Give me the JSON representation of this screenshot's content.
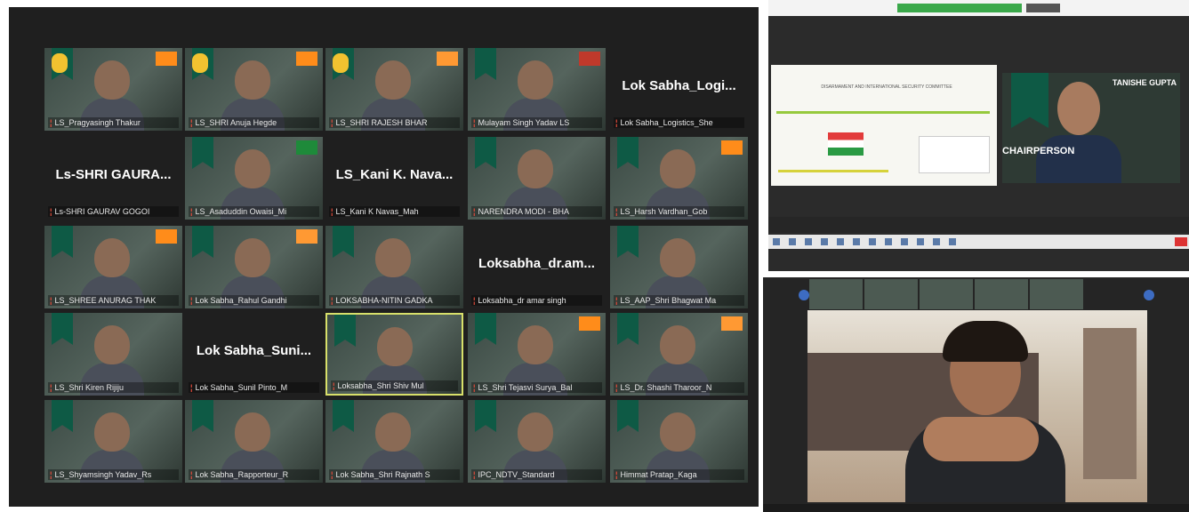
{
  "tiles": [
    {
      "label": "LS_Pragyasingh Thakur",
      "bigname": "",
      "flag": "#ff8c1a",
      "hand": true
    },
    {
      "label": "LS_SHRI Anuja Hegde",
      "bigname": "",
      "flag": "#ff8c1a",
      "hand": true
    },
    {
      "label": "LS_SHRI RAJESH BHAR",
      "bigname": "",
      "flag": "#ff9933",
      "hand": true
    },
    {
      "label": "Mulayam Singh Yadav LS",
      "bigname": "",
      "flag": "#c0392b",
      "hand": false
    },
    {
      "label": "Lok Sabha_Logistics_She",
      "bigname": "Lok Sabha_Logi...",
      "flag": "",
      "hand": false
    },
    {
      "label": "Ls-SHRI GAURAV GOGOI",
      "bigname": "Ls-SHRI GAURA...",
      "flag": "",
      "hand": false
    },
    {
      "label": "LS_Asaduddin Owaisi_Mi",
      "bigname": "",
      "flag": "#1e8a3a",
      "hand": false
    },
    {
      "label": "LS_Kani K Navas_Mah",
      "bigname": "LS_Kani K. Nava...",
      "flag": "",
      "hand": false
    },
    {
      "label": "NARENDRA MODI - BHA",
      "bigname": "",
      "flag": "",
      "hand": false
    },
    {
      "label": "LS_Harsh Vardhan_Gob",
      "bigname": "",
      "flag": "#ff8c1a",
      "hand": false
    },
    {
      "label": "LS_SHREE ANURAG THAK",
      "bigname": "",
      "flag": "#ff8c1a",
      "hand": false
    },
    {
      "label": "Lok Sabha_Rahul Gandhi",
      "bigname": "",
      "flag": "#ff9933",
      "hand": false
    },
    {
      "label": "LOKSABHA-NITIN GADKA",
      "bigname": "",
      "flag": "",
      "hand": false
    },
    {
      "label": "Loksabha_dr amar singh",
      "bigname": "Loksabha_dr.am...",
      "flag": "",
      "hand": false
    },
    {
      "label": "LS_AAP_Shri Bhagwat Ma",
      "bigname": "",
      "flag": "",
      "hand": false
    },
    {
      "label": "LS_Shri Kiren Rijiju",
      "bigname": "",
      "flag": "",
      "hand": false
    },
    {
      "label": "Lok Sabha_Sunil Pinto_M",
      "bigname": "Lok Sabha_Suni...",
      "flag": "",
      "hand": false
    },
    {
      "label": "Loksabha_Shri Shiv Mul",
      "bigname": "",
      "flag": "",
      "hand": false
    },
    {
      "label": "LS_Shri Tejasvi Surya_Bal",
      "bigname": "",
      "flag": "#ff8c1a",
      "hand": false
    },
    {
      "label": "LS_Dr. Shashi Tharoor_N",
      "bigname": "",
      "flag": "#ff9933",
      "hand": false
    },
    {
      "label": "LS_Shyamsingh Yadav_Rs",
      "bigname": "",
      "flag": "",
      "hand": false
    },
    {
      "label": "Lok Sabha_Rapporteur_R",
      "bigname": "",
      "flag": "",
      "hand": false
    },
    {
      "label": "Lok Sabha_Shri Rajnath S",
      "bigname": "",
      "flag": "",
      "hand": false
    },
    {
      "label": "IPC_NDTV_Standard",
      "bigname": "",
      "flag": "",
      "hand": false
    },
    {
      "label": "Himmat Pratap_Kaga",
      "bigname": "",
      "flag": "",
      "hand": false
    }
  ],
  "chair": {
    "name": "TANISHE GUPTA",
    "title": "CHAIRPERSON"
  },
  "doc": {
    "title": "DISARMAMENT AND INTERNATIONAL SECURITY COMMITTEE"
  }
}
